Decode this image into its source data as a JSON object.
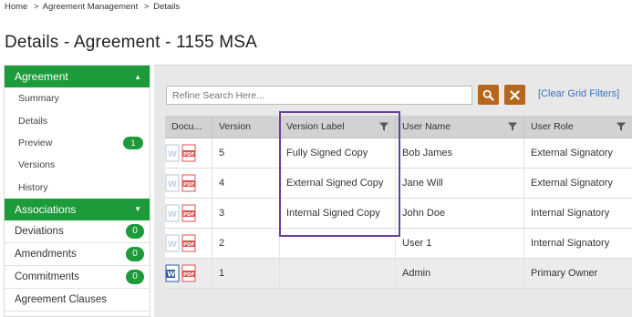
{
  "breadcrumb": {
    "home": "Home",
    "sep1": ">",
    "section": "Agreement Management",
    "sep2": ">",
    "current": "Details"
  },
  "page": {
    "title": "Details - Agreement - 1155 MSA"
  },
  "sidebar": {
    "agreement_header": "Agreement",
    "agreement_items": [
      {
        "label": "Summary",
        "badge": ""
      },
      {
        "label": "Details",
        "badge": ""
      },
      {
        "label": "Preview",
        "badge": "1"
      },
      {
        "label": "Versions",
        "badge": ""
      },
      {
        "label": "History",
        "badge": ""
      }
    ],
    "associations_header": "Associations",
    "associations_items": [
      {
        "label": "Deviations",
        "badge": "0"
      },
      {
        "label": "Amendments",
        "badge": "0"
      },
      {
        "label": "Commitments",
        "badge": "0"
      },
      {
        "label": "Agreement Clauses",
        "badge": ""
      }
    ]
  },
  "search": {
    "placeholder": "Refine Search Here...",
    "clear_filters": "[Clear Grid Filters]"
  },
  "grid": {
    "columns": [
      "Docu...",
      "Version",
      "Version Label",
      "User Name",
      "User Role"
    ],
    "rows": [
      {
        "version": "5",
        "label": "Fully Signed Copy",
        "user": "Bob James",
        "role": "External Signatory",
        "word_active": false
      },
      {
        "version": "4",
        "label": "External Signed Copy",
        "user": "Jane Will",
        "role": "External Signatory",
        "word_active": false
      },
      {
        "version": "3",
        "label": "Internal Signed Copy",
        "user": "John Doe",
        "role": "Internal Signatory",
        "word_active": false
      },
      {
        "version": "2",
        "label": "",
        "user": "User 1",
        "role": "Internal Signatory",
        "word_active": false
      },
      {
        "version": "1",
        "label": "",
        "user": "Admin",
        "role": "Primary Owner",
        "word_active": true
      }
    ]
  },
  "colors": {
    "green": "#1d9a3a",
    "orange": "#b5671d",
    "link": "#3b73b9",
    "highlight": "#6a3fa0"
  }
}
